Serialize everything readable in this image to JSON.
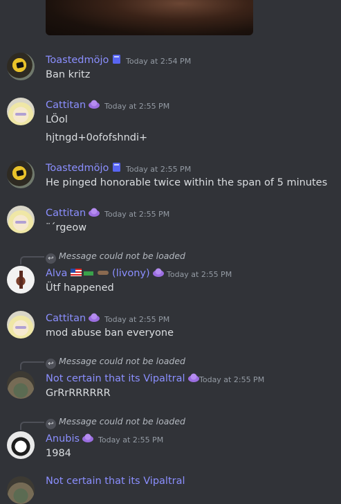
{
  "messages": [
    {
      "author": "Toastedmöjo",
      "badge": "book-icon",
      "time": "Today at 2:54 PM",
      "lines": [
        "Ban kritz"
      ]
    },
    {
      "author": "Cattitan",
      "badge": "role-icon",
      "time": "Today at 2:55 PM",
      "lines": [
        "LÖol",
        "hjtngd+0ofofshndi+"
      ]
    },
    {
      "author": "Toastedmöjo",
      "badge": "book-icon",
      "time": "Today at 2:55 PM",
      "lines": [
        "He pinged honorable twice within the span of 5 minutes"
      ]
    },
    {
      "author": "Cattitan",
      "badge": "role-icon",
      "time": "Today at 2:55 PM",
      "lines": [
        "¨´rgeow"
      ]
    },
    {
      "reply": "Message could not be loaded",
      "author": "Alva",
      "author_extra": "(livony)",
      "time": "Today at 2:55 PM",
      "lines": [
        "Ütf happened"
      ]
    },
    {
      "author": "Cattitan",
      "badge": "role-icon",
      "time": "Today at 2:55 PM",
      "lines": [
        "mod abuse ban everyone"
      ]
    },
    {
      "reply": "Message could not be loaded",
      "author": "Not certain that its Vipaltral",
      "time": "Today at 2:55 PM",
      "lines": [
        "GrRrRRRRRR"
      ]
    },
    {
      "reply": "Message could not be loaded",
      "author": "Anubis",
      "time": "Today at 2:55 PM",
      "lines": [
        "1984"
      ]
    },
    {
      "author": "Not certain that its Vipaltral",
      "partial": true
    }
  ],
  "colors": {
    "background": "#313338",
    "author": "#8b8fff",
    "text": "#dbdee1",
    "timestamp": "#949ba4"
  }
}
